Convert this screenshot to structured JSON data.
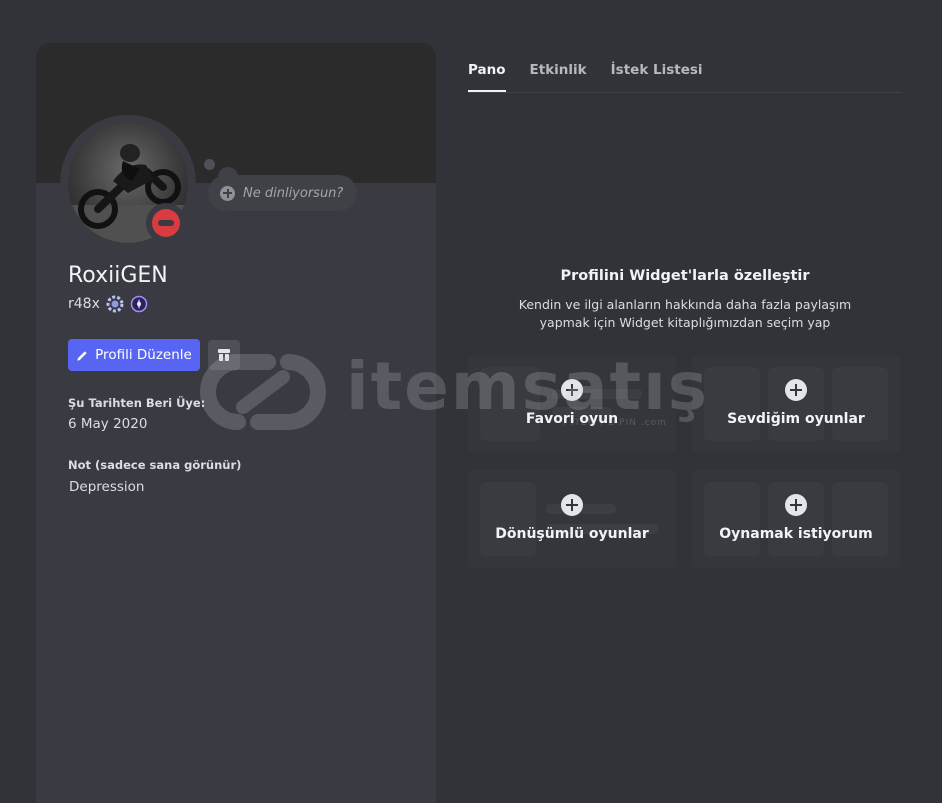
{
  "profile": {
    "status_placeholder": "Ne dinliyorsun?",
    "display_name": "RoxiiGEN",
    "username": "r48x",
    "edit_button": "Profili Düzenle",
    "member_since_label": "Şu Tarihten Beri Üye:",
    "member_since_value": "6 May 2020",
    "note_label": "Not (sadece sana görünür)",
    "note_value": "Depression",
    "status": "do-not-disturb",
    "accent_color": "#5865f2",
    "status_color": "#d83c3e"
  },
  "tabs": [
    {
      "label": "Pano",
      "active": true
    },
    {
      "label": "Etkinlik",
      "active": false
    },
    {
      "label": "İstek Listesi",
      "active": false
    }
  ],
  "empty_state": {
    "title": "Profilini Widget'larla özelleştir",
    "description_line1": "Kendin ve ilgi alanların hakkında daha fazla paylaşım",
    "description_line2": "yapmak için Widget kitaplığımızdan seçim yap"
  },
  "widgets": [
    {
      "label": "Favori oyun"
    },
    {
      "label": "Sevdiğim oyunlar"
    },
    {
      "label": "Dönüşümlü oyunlar"
    },
    {
      "label": "Oynamak istiyorum"
    }
  ],
  "watermark": {
    "text": "itemsatış",
    "subtext": "/ ITEM / E-PIN .com"
  }
}
